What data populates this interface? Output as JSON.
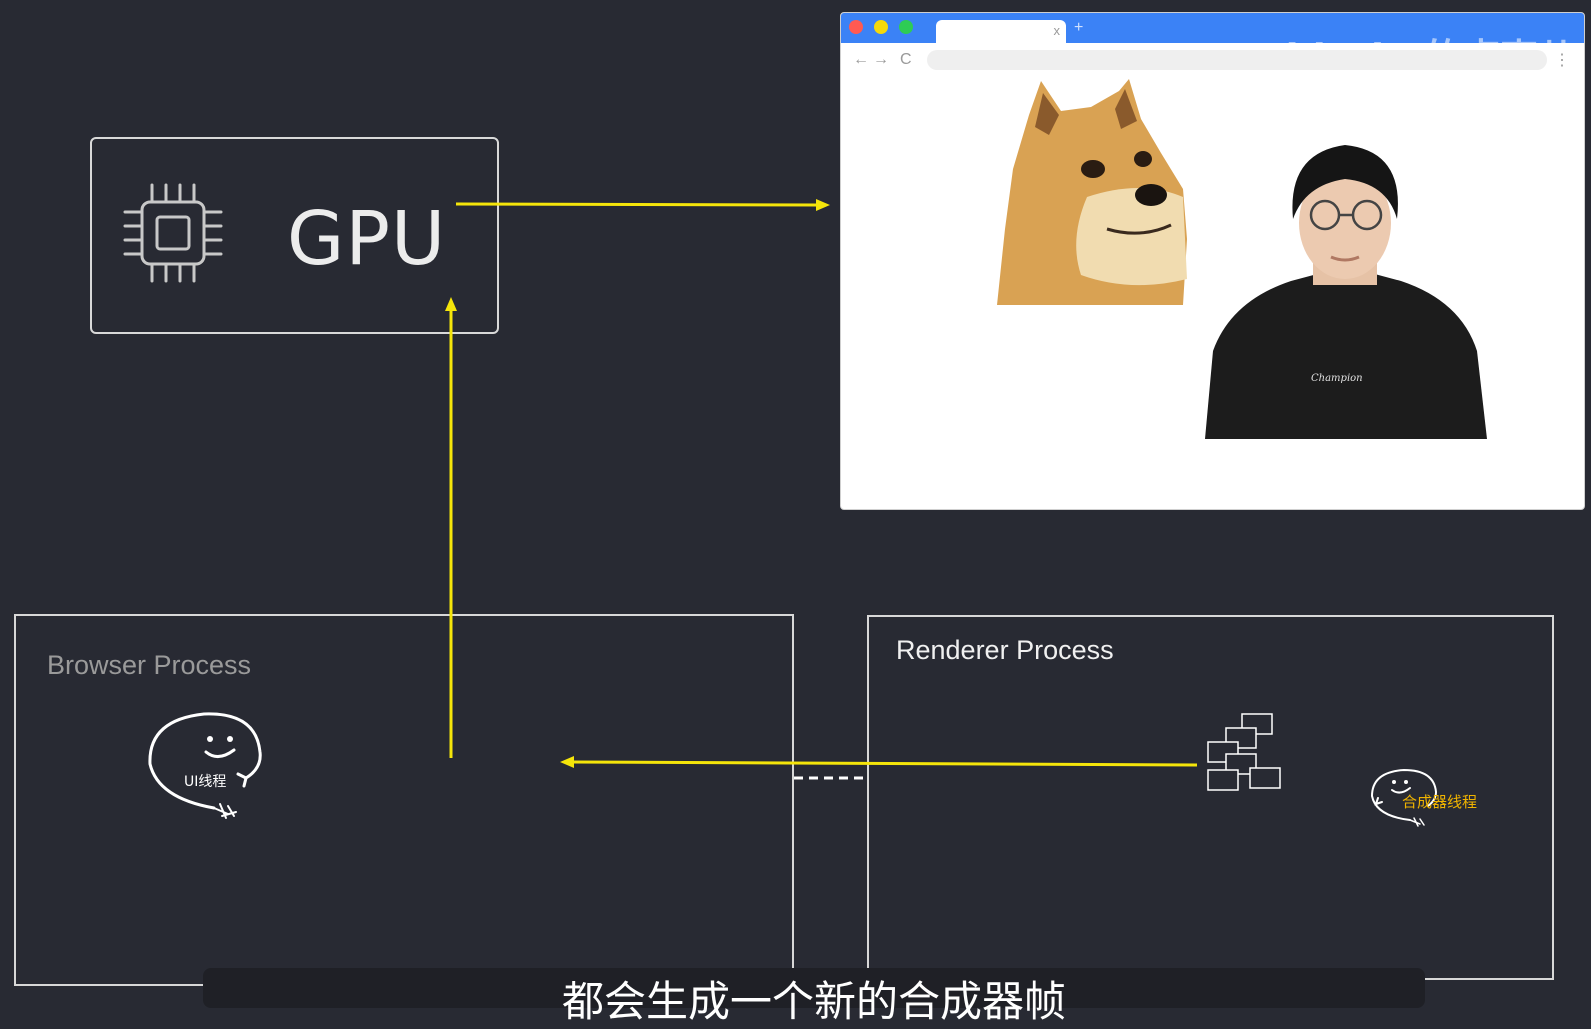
{
  "gpu": {
    "label": "GPU",
    "chip_icon": "cpu-chip-icon"
  },
  "browser_window": {
    "tab_close": "x",
    "tab_add": "+",
    "nav": {
      "back": "←",
      "forward": "→",
      "reload": "C"
    },
    "more": "⋮",
    "watermark": "objtube的卢克儿"
  },
  "browser_process": {
    "title": "Browser Process",
    "ui_thread_label": "UI线程"
  },
  "renderer_process": {
    "title": "Renderer Process",
    "compositor_thread_label": "合成器线程"
  },
  "subtitle": "都会生成一个新的合成器帧",
  "colors": {
    "background": "#282a33",
    "arrow": "#f5e50a",
    "title_bar": "#3b82f6",
    "browser_process_title": "#9a9a9a",
    "renderer_process_title": "#f0f0f0",
    "compositor_label": "#f0b400"
  }
}
